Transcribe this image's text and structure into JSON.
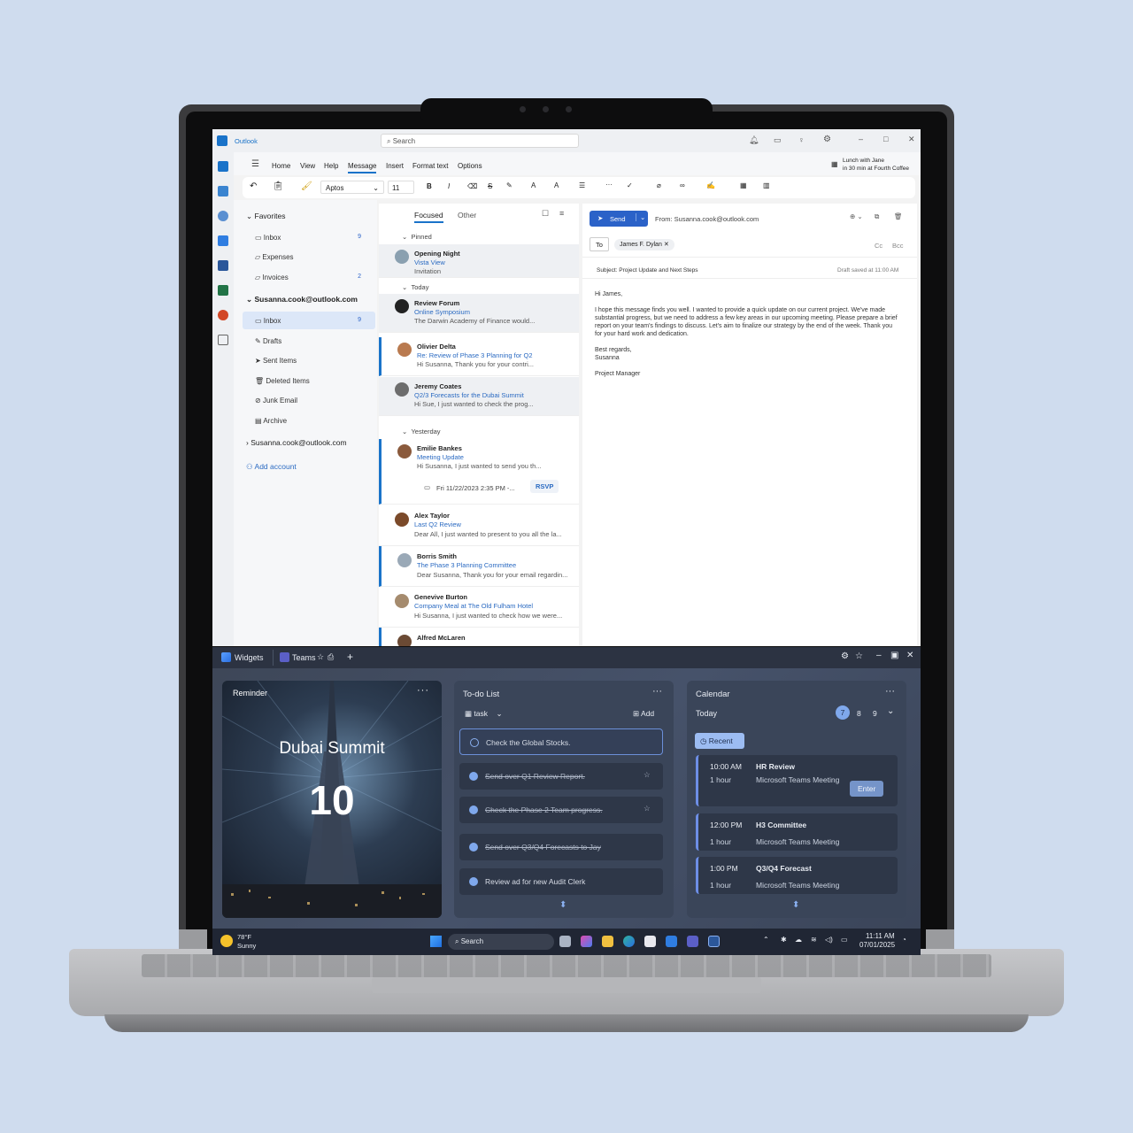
{
  "outlook": {
    "app_name": "Outlook",
    "search_placeholder": "Search",
    "menu": [
      "Home",
      "View",
      "Help",
      "Message",
      "Insert",
      "Format text",
      "Options"
    ],
    "active_menu": "Message",
    "reminder_title": "Lunch with Jane",
    "reminder_sub": "in 30 min at Fourth Coffee",
    "font_name": "Aptos",
    "font_size": "11",
    "favorites_label": "Favorites",
    "favorites": [
      {
        "label": "Inbox",
        "count": "9"
      },
      {
        "label": "Expenses",
        "count": ""
      },
      {
        "label": "Invoices",
        "count": "2"
      }
    ],
    "account": "Susanna.cook@outlook.com",
    "folders": [
      {
        "label": "Inbox",
        "count": "9"
      },
      {
        "label": "Drafts",
        "count": ""
      },
      {
        "label": "Sent Items",
        "count": ""
      },
      {
        "label": "Deleted Items",
        "count": ""
      },
      {
        "label": "Junk Email",
        "count": ""
      },
      {
        "label": "Archive",
        "count": ""
      }
    ],
    "account2": "Susanna.cook@outlook.com",
    "add_account": "Add account",
    "tabs": {
      "focused": "Focused",
      "other": "Other"
    },
    "group_pinned": "Pinned",
    "group_today": "Today",
    "group_yesterday": "Yesterday",
    "mails": [
      {
        "sender": "Opening Night",
        "subject": "Vista View",
        "preview": "Invitation"
      },
      {
        "sender": "Review Forum",
        "subject": "Online Symposium",
        "preview": "The Darwin Academy of Finance would..."
      },
      {
        "sender": "Olivier Delta",
        "subject": "Re: Review of Phase 3 Planning for Q2",
        "preview": "Hi Susanna, Thank you for your contri..."
      },
      {
        "sender": "Jeremy Coates",
        "subject": "Q2/3 Forecasts for the Dubai Summit",
        "preview": "Hi Sue, I just wanted to check the prog..."
      },
      {
        "sender": "Emilie Bankes",
        "subject": "Meeting Update",
        "preview": "Hi Susanna, I just wanted to send you th..."
      },
      {
        "sender": "Alex Taylor",
        "subject": "Last Q2 Review",
        "preview": "Dear All, I just wanted to present to you all the la..."
      },
      {
        "sender": "Borris Smith",
        "subject": "The Phase 3 Planning Committee",
        "preview": "Dear Susanna, Thank you for your email regardin..."
      },
      {
        "sender": "Genevive Burton",
        "subject": "Company Meal at The Old Fulham Hotel",
        "preview": "Hi Susanna, I just wanted to check how we were..."
      },
      {
        "sender": "Alfred McLaren",
        "subject": "",
        "preview": ""
      }
    ],
    "meeting_time": "Fri 11/22/2023 2:35 PM -...",
    "rsvp": "RSVP",
    "compose": {
      "send": "Send",
      "from": "From: Susanna.cook@outlook.com",
      "to_label": "To",
      "to": "James F. Dylan",
      "cc": "Cc",
      "bcc": "Bcc",
      "subject": "Subject: Project Update and Next Steps",
      "draft_saved": "Draft saved at 11:00 AM",
      "greeting": "Hi James,",
      "body": "I hope this message finds you well. I wanted to provide a quick update on our current project. We've made substantial progress, but we need to address a few key areas in our upcoming meeting. Please prepare a brief report on your team's findings to discuss. Let's aim to finalize our strategy by the end of the week. Thank you for your hard work and dedication.",
      "closing": "Best regards,",
      "name": "Susanna",
      "title": "Project Manager"
    }
  },
  "widgets": {
    "tab_widgets": "Widgets",
    "tab_teams": "Teams",
    "reminder": {
      "label": "Reminder",
      "title": "Dubai Summit",
      "number": "10"
    },
    "todo": {
      "label": "To-do List",
      "list_name": "task",
      "add": "Add",
      "items": [
        {
          "text": "Check the Global Stocks.",
          "done": false
        },
        {
          "text": "Send over Q1 Review Report.",
          "done": true
        },
        {
          "text": "Check the Phase 2 Team progress.",
          "done": true
        },
        {
          "text": "Send over Q3/Q4 Forecasts to Jay",
          "done": true
        },
        {
          "text": "Review ad for new Audit Clerk",
          "done": true
        }
      ]
    },
    "calendar": {
      "label": "Calendar",
      "today": "Today",
      "days": [
        "7",
        "8",
        "9"
      ],
      "recent": "Recent",
      "events": [
        {
          "time": "10:00 AM",
          "duration": "1 hour",
          "title": "HR Review",
          "location": "Microsoft Teams Meeting",
          "action": "Enter"
        },
        {
          "time": "12:00 PM",
          "duration": "1 hour",
          "title": "H3 Committee",
          "location": "Microsoft Teams Meeting",
          "action": ""
        },
        {
          "time": "1:00 PM",
          "duration": "1 hour",
          "title": "Q3/Q4 Forecast",
          "location": "Microsoft Teams Meeting",
          "action": ""
        }
      ]
    }
  },
  "taskbar": {
    "temp": "78°F",
    "weather": "Sunny",
    "search": "Search",
    "time": "11:11 AM",
    "date": "07/01/2025"
  }
}
